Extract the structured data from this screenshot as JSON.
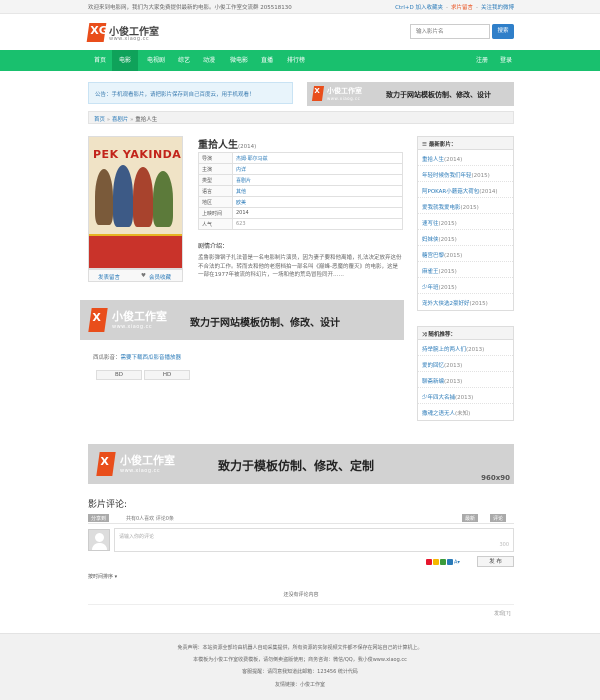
{
  "topbar": {
    "welcome": "欢迎来到电影网，我们为大家免费提供最新的电影。小俊工作室交流群 205518130",
    "fav": "Ctrl+D 加入收藏夹",
    "ask": "求片留言",
    "follow": "关注我的微博"
  },
  "logo": {
    "mark": "XG",
    "title": "小俊工作室",
    "url": "www.xiaog.cc"
  },
  "search": {
    "placeholder": "输入影片名",
    "button": "搜索"
  },
  "nav": {
    "items": [
      "首页",
      "电影",
      "电视剧",
      "综艺",
      "动漫",
      "微电影",
      "直播",
      "排行榜"
    ],
    "register": "注册",
    "login": "登录"
  },
  "announcement": "公告：手机观看影片，请把影片保存到自己百度云，用手机观看！",
  "banners": {
    "small": {
      "title": "小俊工作室",
      "url": "www.xiaog.cc",
      "slogan": "致力于网站模板仿制、修改、设计"
    },
    "mid": {
      "title": "小俊工作室",
      "url": "www.xiaog.cc",
      "slogan": "致力于网站模板仿制、修改、设计"
    },
    "wide": {
      "title": "小俊工作室",
      "url": "www.xiaog.cc",
      "slogan": "致力于模板仿制、修改、定制",
      "size": "960x90"
    }
  },
  "breadcrumb": {
    "home": "首页",
    "sep1": "»",
    "cat": "喜剧片",
    "sep2": "»",
    "current": "重拾人生"
  },
  "movie": {
    "title": "重拾人生",
    "year": "(2014)",
    "poster_text": "PEK YAKINDA",
    "rows": [
      {
        "k": "导演",
        "v": "杰姆·耶尔马兹"
      },
      {
        "k": "主演",
        "v": "内详"
      },
      {
        "k": "类型",
        "v": "喜剧片"
      },
      {
        "k": "语言",
        "v": "其他"
      },
      {
        "k": "地区",
        "v": "欧美"
      },
      {
        "k": "上映时间",
        "v": "2014"
      },
      {
        "k": "人气",
        "v": "623"
      }
    ],
    "intro_heading": "剧情介绍：",
    "intro": "孟鲁影弹钢子扎法普是一名电影制片演员，因为妻子要和他离婚，扎法决定放弃这份不合法的工作。转而去和他的老搭档拍一部名叫《巅峰-恶魔的覆灭》的电影，这是一部在1977年被流的科幻片，一场和他的荒岛冒险同开……",
    "send_msg": "发表留言",
    "fav": "会员收藏"
  },
  "sidebar_latest": {
    "heading": "最新影片：",
    "items": [
      {
        "t": "重拾人生",
        "y": "(2014)"
      },
      {
        "t": "年轻时候伤我们年轻",
        "y": "(2015)"
      },
      {
        "t": "阿POKAR小蘑菇大荷包",
        "y": "(2014)"
      },
      {
        "t": "爱我就我爱电影",
        "y": "(2015)"
      },
      {
        "t": "速写往",
        "y": "(2015)"
      },
      {
        "t": "妈妹侠",
        "y": "(2015)"
      },
      {
        "t": "糖宫巴黎",
        "y": "(2015)"
      },
      {
        "t": "麻雀王",
        "y": "(2015)"
      },
      {
        "t": "少年班",
        "y": "(2015)"
      },
      {
        "t": "宠外大侠选2豪好好",
        "y": "(2015)"
      }
    ]
  },
  "sidebar_random": {
    "heading": "随机推荐：",
    "items": [
      {
        "t": "持举腕上的两人们",
        "y": "(2013)"
      },
      {
        "t": "爱的回忆",
        "y": "(2013)"
      },
      {
        "t": "聊斋新编",
        "y": "(2013)"
      },
      {
        "t": "少年四大名捕",
        "y": "(2013)"
      },
      {
        "t": "撒魂之语无人",
        "y": "(未知)"
      }
    ]
  },
  "play": {
    "label": "西瓜影音：",
    "link": "需要下载西瓜影音播放器",
    "sources": [
      "BD",
      "HD"
    ]
  },
  "comments": {
    "heading": "影片评论:",
    "tag_a": "分享到",
    "count_text": "共有0人喜欢  评论0条",
    "btn1": "最新",
    "btn2": "评论",
    "placeholder": "请输入你的评论",
    "counter": "300",
    "send": "发 布",
    "sort": "按时间排序",
    "empty": "还没有评论内容",
    "feedback": "发现[?]"
  },
  "footer": {
    "line1": "免责声明：本站资源全部均由机器人自动采集提供，所有资源的实际视频文件都不保存在网站自己的计算机上。",
    "line2": "本模板为小俊工作室收费模板，请勿倒卖盗版使用；商务咨询：微信/QQ，我小俊www.xiaog.cc",
    "line3": "客服提醒：请同意我知道此邮箱：123456 统计代码",
    "line4": "友情链接：小俊工作室"
  },
  "colors": {
    "nav": "#19c06e",
    "nav_active": "#0fa25a",
    "accent": "#e94e1b",
    "link": "#2a7ab8",
    "banner_bg": "#d2d2d2"
  }
}
